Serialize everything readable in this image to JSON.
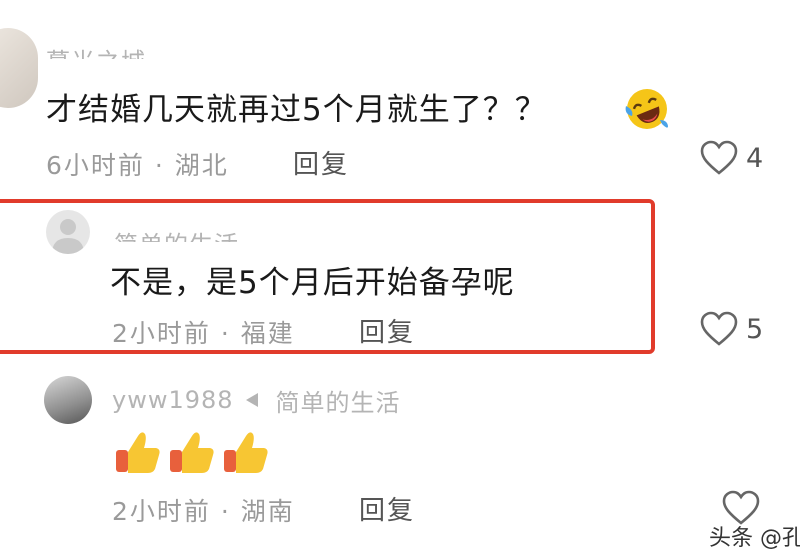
{
  "comments": [
    {
      "username": "暮光之城",
      "text": "才结婚几天就再过5个月就生了？？",
      "emoji_icon": "laughing-tears-emoji",
      "time_location": "6小时前 · 湖北",
      "reply_label": "回复",
      "likes": "4"
    },
    {
      "username": "简单的生活",
      "text": "不是，是5个月后开始备孕呢",
      "time_location": "2小时前 · 福建",
      "reply_label": "回复",
      "likes": "5"
    },
    {
      "username": "yww1988",
      "reply_to": "简单的生活",
      "text_icons": [
        "thumbs-up-emoji",
        "thumbs-up-emoji",
        "thumbs-up-emoji"
      ],
      "time_location": "2小时前 · 湖南",
      "reply_label": "回复"
    }
  ],
  "watermark": "头条 @孔"
}
